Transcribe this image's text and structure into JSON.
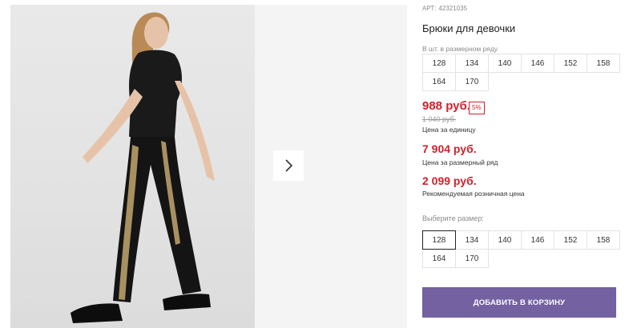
{
  "product": {
    "sku_label": "АРТ:",
    "sku": "42321035",
    "title": "Брюки для девочки"
  },
  "size_set": {
    "hint": "В шт. в размерном ряду",
    "sizes": [
      "128",
      "134",
      "140",
      "146",
      "152",
      "158",
      "164",
      "170"
    ]
  },
  "prices": {
    "unit_price": "988 руб.",
    "discount": "5%",
    "old_price": "1 040 руб.",
    "unit_note": "Цена за единицу",
    "set_price": "7 904 руб.",
    "set_note": "Цена за размерный ряд",
    "rrp": "2 099 руб.",
    "rrp_note": "Рекомендуемая розничная цена",
    "accent_color": "#d3202e"
  },
  "size_select": {
    "label": "Выберите размер:",
    "sizes": [
      "128",
      "134",
      "140",
      "146",
      "152",
      "158",
      "164",
      "170"
    ],
    "selected": "128"
  },
  "cart": {
    "button_label": "ДОБАВИТЬ В КОРЗИНУ",
    "button_color": "#7361a2"
  },
  "gallery": {
    "next_icon": "chevron-right-icon"
  }
}
